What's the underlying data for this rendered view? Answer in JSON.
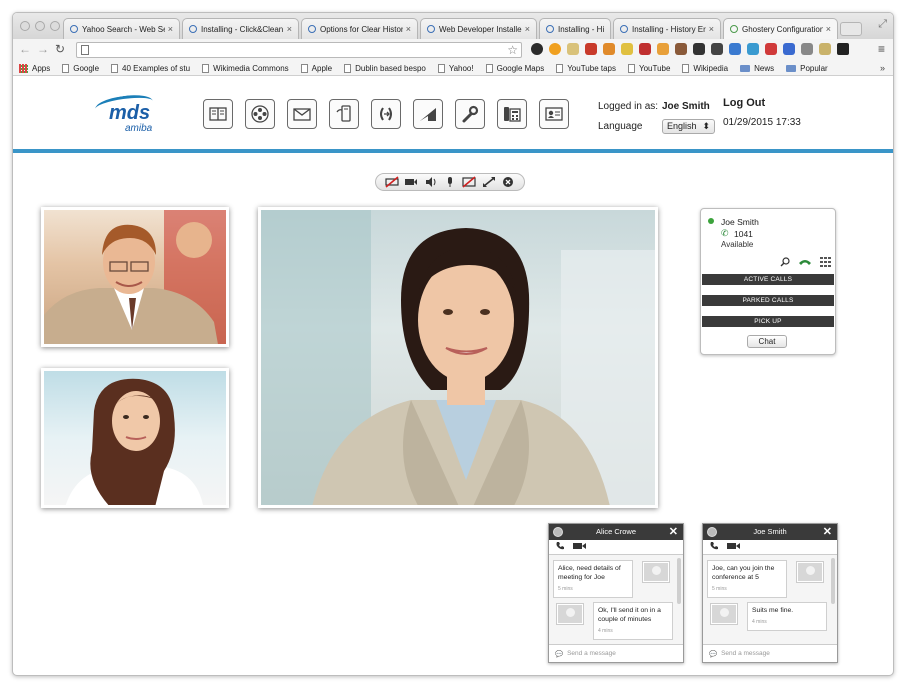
{
  "browser": {
    "tabs": [
      {
        "label": "Yahoo Search - Web Sea",
        "close": "×"
      },
      {
        "label": "Installing - Click&Clean",
        "close": "×"
      },
      {
        "label": "Options for Clear Histor",
        "close": "×"
      },
      {
        "label": "Web Developer Installed",
        "close": "×"
      },
      {
        "label": "Installing - Histo",
        "close": ""
      },
      {
        "label": "Installing - History Erase",
        "close": "×"
      },
      {
        "label": "Ghostery Configuration",
        "close": "×"
      }
    ],
    "address": "",
    "bookmarks": [
      {
        "label": "Apps",
        "icon": "apps-grid-icon"
      },
      {
        "label": "Google",
        "icon": "page-icon"
      },
      {
        "label": "40 Examples of stu",
        "icon": "page-icon"
      },
      {
        "label": "Wikimedia Commons",
        "icon": "page-icon"
      },
      {
        "label": "Apple",
        "icon": "page-icon"
      },
      {
        "label": "Dublin based bespo",
        "icon": "page-icon"
      },
      {
        "label": "Yahoo!",
        "icon": "page-icon"
      },
      {
        "label": "Google Maps",
        "icon": "page-icon"
      },
      {
        "label": "YouTube taps",
        "icon": "page-icon"
      },
      {
        "label": "YouTube",
        "icon": "page-icon"
      },
      {
        "label": "Wikipedia",
        "icon": "page-icon"
      },
      {
        "label": "News",
        "icon": "folder-icon"
      },
      {
        "label": "Popular",
        "icon": "folder-icon"
      }
    ],
    "bookmarks_more": "»"
  },
  "app": {
    "logo_text": "mds",
    "logo_sub": "amiba",
    "nav_icons": [
      "directory-book-icon",
      "conference-group-icon",
      "mail-icon",
      "mobile-phone-icon",
      "call-forward-icon",
      "signal-meter-icon",
      "settings-wrench-icon",
      "desk-phone-icon",
      "contact-card-icon"
    ],
    "logged_in_label": "Logged in as:",
    "user_name": "Joe Smith",
    "logout_label": "Log Out",
    "language_label": "Language",
    "language_value": "English",
    "datetime": "01/29/2015 17:33",
    "accent_color": "#3a95c8"
  },
  "video_controls": [
    "video-off-icon",
    "camera-icon",
    "speaker-icon",
    "microphone-icon",
    "screen-share-off-icon",
    "fullscreen-icon",
    "close-circle-icon"
  ],
  "contact_panel": {
    "name": "Joe Smith",
    "extension": "1041",
    "status": "Available",
    "sections": [
      "ACTIVE CALLS",
      "PARKED CALLS",
      "PICK UP"
    ],
    "chat_button": "Chat"
  },
  "chats": [
    {
      "title": "Alice Crowe",
      "messages": [
        {
          "text": "Alice, need details of meeting for Joe",
          "time": "5 mins",
          "side": "left"
        },
        {
          "text": "Ok, I'll send it on in a couple of minutes",
          "time": "4 mins",
          "side": "right"
        }
      ],
      "input_placeholder": "Send a message"
    },
    {
      "title": "Joe Smith",
      "messages": [
        {
          "text": "Joe, can you join the conference at 5",
          "time": "5 mins",
          "side": "left"
        },
        {
          "text": "Suits me fine.",
          "time": "4 mins",
          "side": "right"
        }
      ],
      "input_placeholder": "Send a message"
    }
  ]
}
